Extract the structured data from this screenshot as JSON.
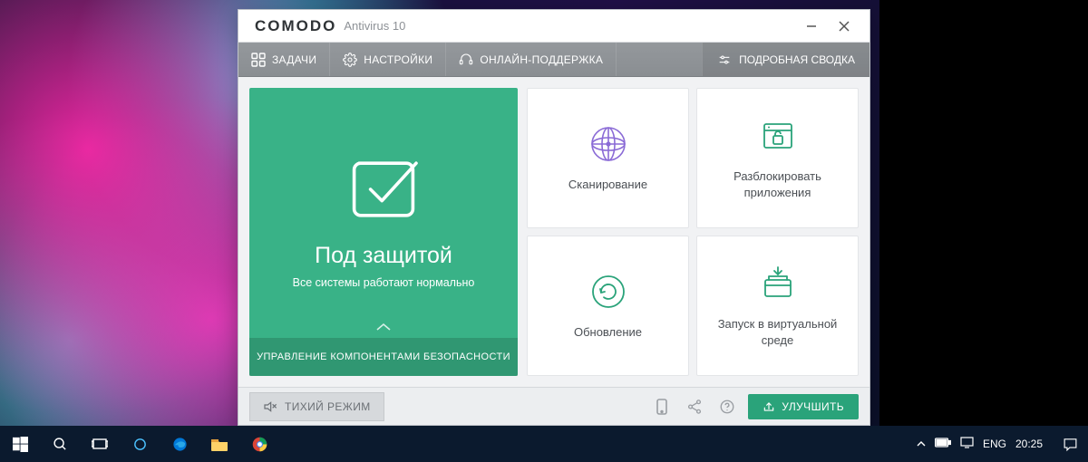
{
  "app": {
    "brand": "COMODO",
    "product": "Antivirus 10"
  },
  "toolbar": {
    "tasks": "ЗАДАЧИ",
    "settings": "НАСТРОЙКИ",
    "support": "ОНЛАЙН-ПОДДЕРЖКА",
    "summary": "ПОДРОБНАЯ СВОДКА"
  },
  "status": {
    "title": "Под защитой",
    "subtitle": "Все системы работают нормально",
    "footer": "УПРАВЛЕНИЕ КОМПОНЕНТАМИ БЕЗОПАСНОСТИ"
  },
  "tiles": {
    "scan": "Сканирование",
    "unblock": "Разблокировать приложения",
    "update": "Обновление",
    "vrun": "Запуск в виртуальной среде"
  },
  "bottom": {
    "quiet": "ТИХИЙ РЕЖИМ",
    "upgrade": "УЛУЧШИТЬ"
  },
  "taskbar": {
    "lang": "ENG",
    "clock": "20:25"
  },
  "colors": {
    "accent_green": "#2aa37a",
    "panel_green": "#39b287",
    "toolbar_gray": "#8e9296",
    "scan_purple": "#8a6ad6",
    "taskbar_bg": "#0b1a2e"
  }
}
